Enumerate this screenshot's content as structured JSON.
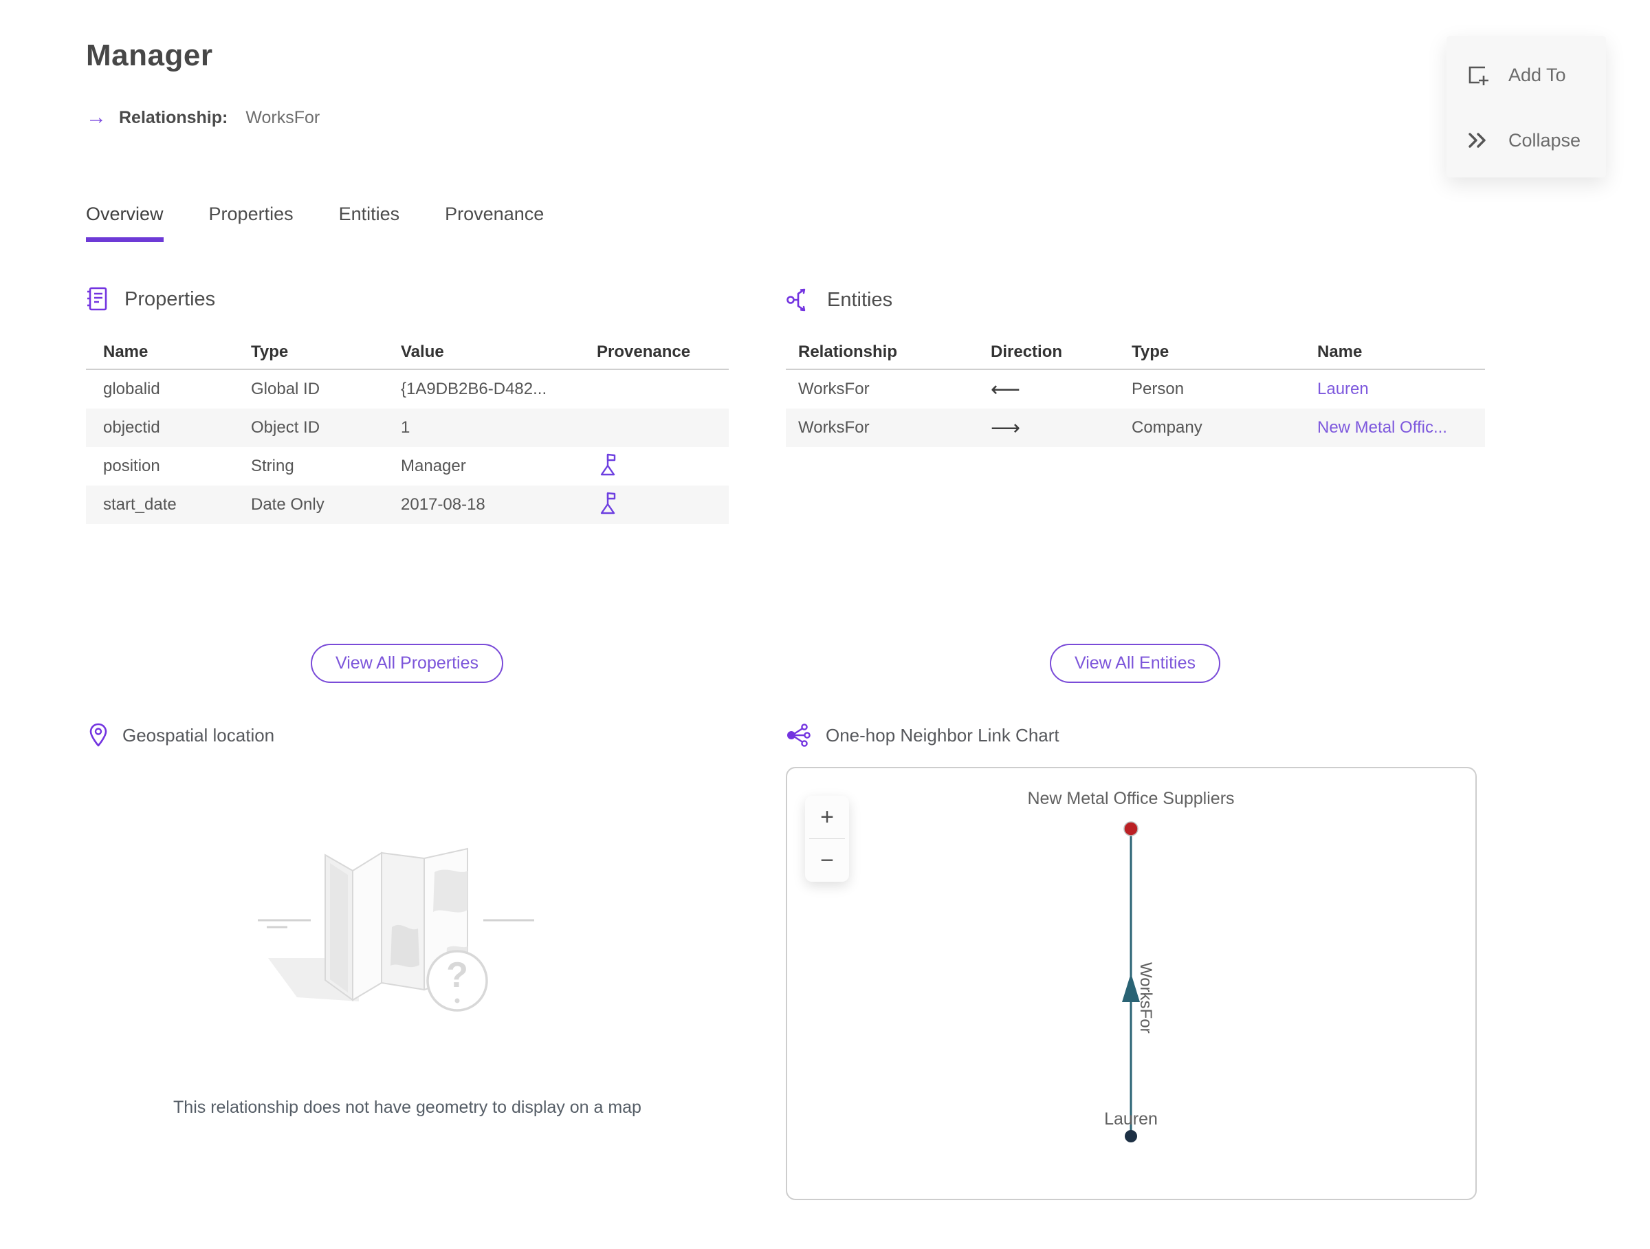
{
  "header": {
    "title": "Manager",
    "subtitle_label": "Relationship:",
    "subtitle_value": "WorksFor",
    "subtitle_arrow": "→"
  },
  "actions": {
    "add_to": "Add To",
    "collapse": "Collapse"
  },
  "tabs": [
    {
      "label": "Overview",
      "active": true
    },
    {
      "label": "Properties",
      "active": false
    },
    {
      "label": "Entities",
      "active": false
    },
    {
      "label": "Provenance",
      "active": false
    }
  ],
  "properties_section": {
    "title": "Properties",
    "columns": [
      "Name",
      "Type",
      "Value",
      "Provenance"
    ],
    "rows": [
      {
        "name": "globalid",
        "type": "Global ID",
        "value": "{1A9DB2B6-D482...",
        "has_provenance_flag": false
      },
      {
        "name": "objectid",
        "type": "Object ID",
        "value": "1",
        "has_provenance_flag": false
      },
      {
        "name": "position",
        "type": "String",
        "value": "Manager",
        "has_provenance_flag": true
      },
      {
        "name": "start_date",
        "type": "Date Only",
        "value": "2017-08-18",
        "has_provenance_flag": true
      }
    ],
    "view_all_label": "View All Properties"
  },
  "entities_section": {
    "title": "Entities",
    "columns": [
      "Relationship",
      "Direction",
      "Type",
      "Name"
    ],
    "rows": [
      {
        "relationship": "WorksFor",
        "direction_char": "⟵",
        "type": "Person",
        "name": "Lauren"
      },
      {
        "relationship": "WorksFor",
        "direction_char": "⟶",
        "type": "Company",
        "name": "New Metal Offic..."
      }
    ],
    "view_all_label": "View All Entities"
  },
  "geospatial_section": {
    "title": "Geospatial location",
    "empty_message": "This relationship does not have geometry to display on a map"
  },
  "link_chart_section": {
    "title": "One-hop Neighbor Link Chart",
    "zoom_in_label": "+",
    "zoom_out_label": "−",
    "chart": {
      "top_node": {
        "label": "New Metal Office Suppliers",
        "color": "#bb2024"
      },
      "bottom_node": {
        "label": "Lauren",
        "color": "#1d3044"
      },
      "edge": {
        "label": "WorksFor",
        "color": "#2a6374",
        "arrow_direction": "up"
      }
    }
  },
  "colors": {
    "accent_purple": "#6d3ad6",
    "link_purple": "#7d58dd",
    "edge_teal": "#2a6374",
    "node_red": "#bb2024",
    "node_navy": "#1d3044"
  }
}
